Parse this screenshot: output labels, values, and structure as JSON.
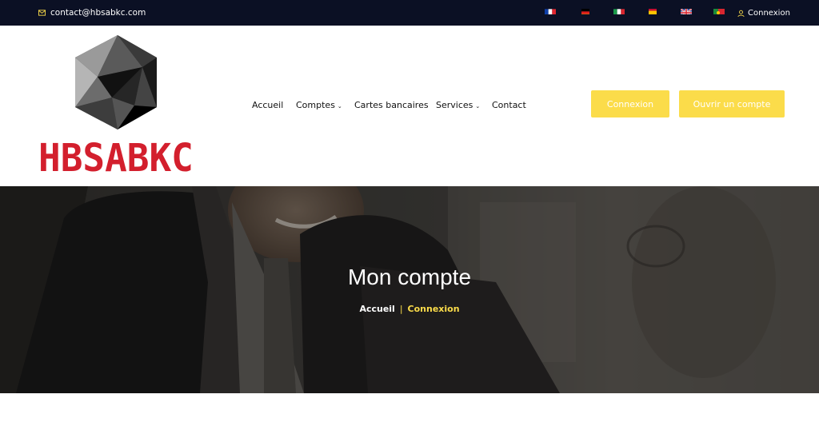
{
  "topbar": {
    "email": "contact@hbsabkc.com",
    "email_icon": "envelope-icon",
    "flags": [
      "flag-fr-icon",
      "flag-de-icon",
      "flag-it-icon",
      "flag-es-icon",
      "flag-uk-icon",
      "flag-pt-icon"
    ],
    "login_label": "Connexion",
    "login_icon": "user-icon"
  },
  "header": {
    "logo_text": "HBSABKC",
    "nav": [
      {
        "label": "Accueil",
        "dropdown": false
      },
      {
        "label": "Comptes",
        "dropdown": true
      },
      {
        "label": "Cartes bancaires",
        "dropdown": false
      },
      {
        "label": "Services",
        "dropdown": true
      },
      {
        "label": "Contact",
        "dropdown": false
      }
    ],
    "login_button": "Connexion",
    "open_account_button": "Ouvrir un compte"
  },
  "hero": {
    "title": "Mon compte",
    "breadcrumb_home": "Accueil",
    "breadcrumb_sep": "|",
    "breadcrumb_current": "Connexion"
  },
  "colors": {
    "topbar_bg": "#0b1024",
    "accent_yellow": "#fbdc4a",
    "logo_red": "#d31f2d"
  }
}
